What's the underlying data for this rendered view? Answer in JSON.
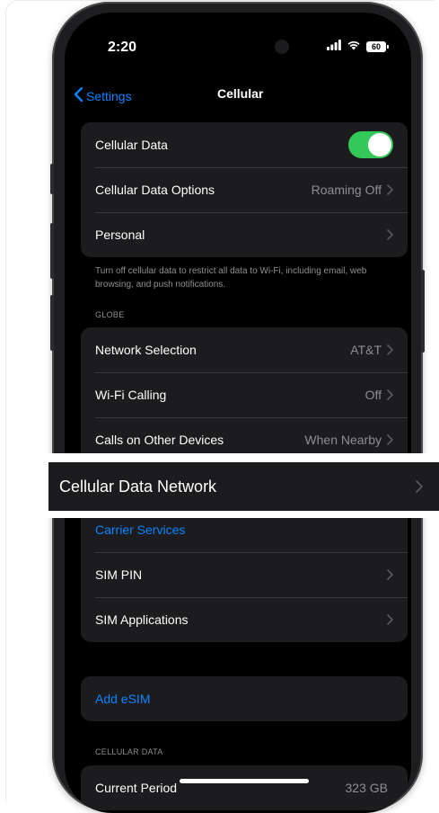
{
  "status_bar": {
    "time": "2:20",
    "battery": "60"
  },
  "nav": {
    "back_label": "Settings",
    "title": "Cellular"
  },
  "group1": {
    "cellular_data": {
      "label": "Cellular Data",
      "enabled": true
    },
    "cellular_data_options": {
      "label": "Cellular Data Options",
      "value": "Roaming Off"
    },
    "personal": {
      "label": "Personal"
    }
  },
  "group1_footer": "Turn off cellular data to restrict all data to Wi-Fi, including email, web browsing, and push notifications.",
  "section_globe": "GLOBE",
  "group2": {
    "network_selection": {
      "label": "Network Selection",
      "value": "AT&T"
    },
    "wifi_calling": {
      "label": "Wi-Fi Calling",
      "value": "Off"
    },
    "calls_other_devices": {
      "label": "Calls on Other Devices",
      "value": "When Nearby"
    },
    "cellular_data_network": {
      "label": "Cellular Data Network"
    },
    "carrier_services": {
      "label": "Carrier Services"
    },
    "sim_pin": {
      "label": "SIM PIN"
    },
    "sim_applications": {
      "label": "SIM Applications"
    }
  },
  "group3": {
    "add_esim": {
      "label": "Add eSIM"
    }
  },
  "section_cellular_data": "CELLULAR DATA",
  "group4": {
    "current_period": {
      "label": "Current Period",
      "value": "323 GB"
    }
  },
  "colors": {
    "accent": "#0a84ff",
    "toggle_on": "#34c759",
    "background": "#000000",
    "cell": "#1c1c1e"
  },
  "icons": {
    "back": "chevron-left-icon",
    "disclosure": "chevron-right-icon",
    "signal": "signal-icon",
    "wifi": "wifi-icon",
    "battery": "battery-icon"
  }
}
